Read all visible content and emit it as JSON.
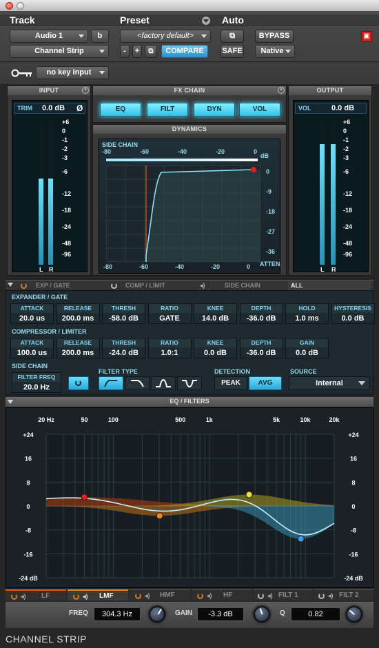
{
  "header": {
    "track_label": "Track",
    "preset_label": "Preset",
    "auto_label": "Auto",
    "track_name": "Audio 1",
    "track_channel": "b",
    "insert_name": "Channel Strip",
    "preset_name": "<factory default>",
    "minus": "-",
    "plus": "+",
    "compare": "COMPARE",
    "safe": "SAFE",
    "bypass": "BYPASS",
    "native": "Native",
    "key_input": "no key input"
  },
  "input": {
    "title": "INPUT",
    "trim_label": "TRIM",
    "trim_value": "0.0 dB",
    "phase": "Ø",
    "scale": [
      "+6",
      "0",
      "-1",
      "-2",
      "-3",
      "-6",
      "-12",
      "-18",
      "-24",
      "-48",
      "-96"
    ],
    "l": "L",
    "r": "R",
    "level_l": 0.6,
    "level_r": 0.6
  },
  "output": {
    "title": "OUTPUT",
    "vol_label": "VOL",
    "vol_value": "0.0 dB",
    "scale": [
      "+6",
      "0",
      "-1",
      "-2",
      "-3",
      "-6",
      "-12",
      "-18",
      "-24",
      "-48",
      "-96"
    ],
    "l": "L",
    "r": "R",
    "level_l": 0.84,
    "level_r": 0.84
  },
  "fx_chain": {
    "title": "FX CHAIN",
    "buttons": [
      "EQ",
      "FILT",
      "DYN",
      "VOL"
    ]
  },
  "dynamics": {
    "title": "DYNAMICS",
    "side_chain": "SIDE CHAIN",
    "db": "dB",
    "atten": "ATTEN",
    "top_ticks": [
      "-80",
      "-60",
      "-40",
      "-20",
      "0"
    ],
    "bottom_ticks": [
      "-80",
      "-60",
      "-40",
      "-20",
      "0"
    ],
    "right_ticks": [
      "0",
      "-9",
      "-18",
      "-27",
      "-36"
    ]
  },
  "tabs": {
    "exp_gate": "EXP / GATE",
    "comp_limit": "COMP / LIMIT",
    "side_chain": "SIDE CHAIN",
    "all": "ALL"
  },
  "expander": {
    "title": "EXPANDER / GATE",
    "params": [
      {
        "label": "ATTACK",
        "value": "20.0 us"
      },
      {
        "label": "RELEASE",
        "value": "200.0 ms"
      },
      {
        "label": "THRESH",
        "value": "-58.0 dB"
      },
      {
        "label": "RATIO",
        "value": "GATE"
      },
      {
        "label": "KNEE",
        "value": "14.0 dB"
      },
      {
        "label": "DEPTH",
        "value": "-36.0 dB"
      },
      {
        "label": "HOLD",
        "value": "1.0 ms"
      },
      {
        "label": "HYSTERESIS",
        "value": "0.0 dB"
      }
    ]
  },
  "compressor": {
    "title": "COMPRESSOR / LIMITER",
    "params": [
      {
        "label": "ATTACK",
        "value": "100.0 us"
      },
      {
        "label": "RELEASE",
        "value": "200.0 ms"
      },
      {
        "label": "THRESH",
        "value": "-24.0 dB"
      },
      {
        "label": "RATIO",
        "value": "1.0:1"
      },
      {
        "label": "KNEE",
        "value": "0.0 dB"
      },
      {
        "label": "DEPTH",
        "value": "-36.0 dB"
      },
      {
        "label": "GAIN",
        "value": "0.0 dB"
      }
    ]
  },
  "sidechain": {
    "title": "SIDE CHAIN",
    "filter_freq_label": "FILTER FREQ",
    "filter_freq_value": "20.0 Hz",
    "filter_type_label": "FILTER TYPE",
    "detection_label": "DETECTION",
    "peak": "PEAK",
    "avg": "AVG",
    "source_label": "SOURCE",
    "source_value": "Internal"
  },
  "eq": {
    "title": "EQ / FILTERS",
    "freq_ticks": [
      "20 Hz",
      "50",
      "100",
      "500",
      "1k",
      "5k",
      "10k",
      "20k"
    ],
    "db_ticks_left": [
      "+24",
      "16",
      "8",
      "0",
      "-8",
      "-16",
      "-24 dB"
    ],
    "db_ticks_right": [
      "+24",
      "16",
      "8",
      "0",
      "-8",
      "-16",
      "-24 dB"
    ],
    "bands": [
      "LF",
      "LMF",
      "HMF",
      "HF",
      "FILT 1",
      "FILT 2"
    ],
    "freq_label": "FREQ",
    "freq_value": "304.3 Hz",
    "gain_label": "GAIN",
    "gain_value": "-3.3 dB",
    "q_label": "Q",
    "q_value": "0.82",
    "nodes": [
      {
        "band": "LF",
        "freq_hz": 50,
        "gain_db": 3.0,
        "color": "#e02020"
      },
      {
        "band": "LMF",
        "freq_hz": 304.3,
        "gain_db": -3.3,
        "color": "#f08a20"
      },
      {
        "band": "HMF",
        "freq_hz": 2600,
        "gain_db": 3.8,
        "color": "#f0e040"
      },
      {
        "band": "HF",
        "freq_hz": 9000,
        "gain_db": -11,
        "color": "#3a9cf0"
      }
    ]
  },
  "footer": {
    "name": "CHANNEL STRIP"
  },
  "colors": {
    "accent": "#3cd6ff",
    "cyan_text": "#7ed7f0",
    "panel": "#3a3a3a"
  }
}
